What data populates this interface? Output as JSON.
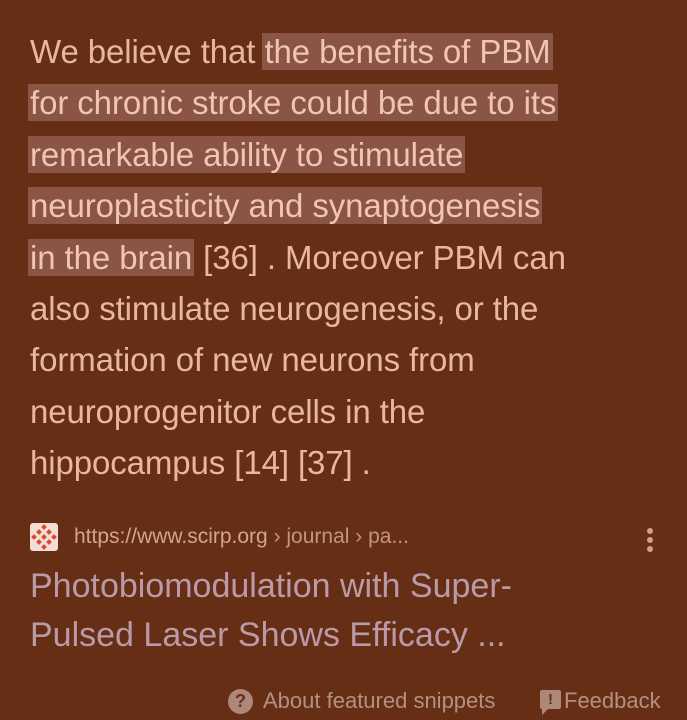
{
  "snippet": {
    "lines": [
      {
        "pre": "We believe that ",
        "hl": "the benefits of PBM",
        "post": ""
      },
      {
        "pre": "",
        "hl": "for chronic stroke could be due to its",
        "post": ""
      },
      {
        "pre": "",
        "hl": "remarkable ability to stimulate",
        "post": ""
      },
      {
        "pre": "",
        "hl": "neuroplasticity and synaptogenesis",
        "post": ""
      },
      {
        "pre": "",
        "hl": "in the brain",
        "post": " [36] . Moreover PBM can"
      },
      {
        "pre": "also stimulate neurogenesis, or the",
        "hl": "",
        "post": ""
      },
      {
        "pre": "formation of new neurons from",
        "hl": "",
        "post": ""
      },
      {
        "pre": "neuroprogenitor cells in the",
        "hl": "",
        "post": ""
      },
      {
        "pre": "hippocampus [14] [37] .",
        "hl": "",
        "post": ""
      }
    ]
  },
  "source": {
    "favicon": "scirp-favicon-icon",
    "url": "https://www.scirp.org",
    "breadcrumb": " › journal › pa...",
    "menu_icon": "more-vert-icon"
  },
  "result": {
    "title_line1": "Photobiomodulation with Super-",
    "title_line2": "Pulsed Laser Shows Efficacy ..."
  },
  "footer": {
    "about_icon": "help-circle-icon",
    "about_label": "About featured snippets",
    "feedback_icon": "feedback-icon",
    "feedback_label": "Feedback"
  },
  "colors": {
    "background": "#662f15",
    "snippet_text": "#e8b79f",
    "highlight": "#8a5544",
    "title_link": "#ba9aa8"
  }
}
